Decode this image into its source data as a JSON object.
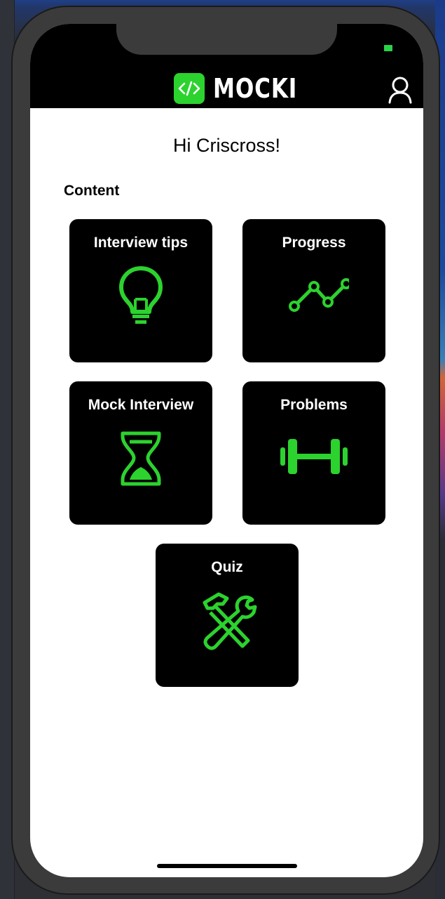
{
  "app": {
    "brand_name": "MOCKI",
    "accent_color": "#2cd22e"
  },
  "header": {
    "logo_icon": "code-brackets-icon",
    "profile_icon": "user-icon"
  },
  "main": {
    "greeting": "Hi Criscross!",
    "section_title": "Content",
    "cards": [
      {
        "label": "Interview tips",
        "icon": "lightbulb-icon"
      },
      {
        "label": "Progress",
        "icon": "line-chart-icon"
      },
      {
        "label": "Mock Interview",
        "icon": "hourglass-icon"
      },
      {
        "label": "Problems",
        "icon": "dumbbell-icon"
      },
      {
        "label": "Quiz",
        "icon": "tools-icon"
      }
    ]
  }
}
